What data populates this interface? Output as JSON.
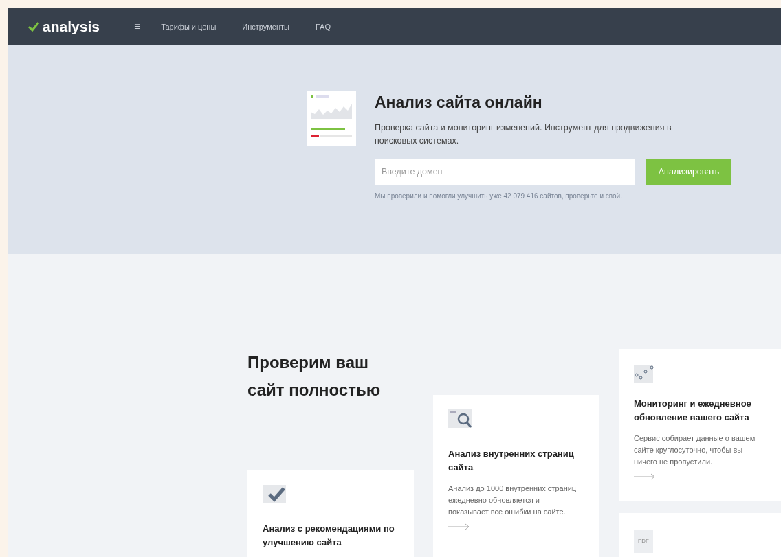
{
  "nav": {
    "logo": "analysis",
    "menu_icon": "≡",
    "links": [
      "Тарифы и цены",
      "Инструменты",
      "FAQ"
    ]
  },
  "hero": {
    "title": "Анализ сайта онлайн",
    "subtitle": "Проверка сайта и мониторинг изменений. Инструмент для продвижения в поисковых системах.",
    "search": {
      "placeholder": "Введите домен"
    },
    "button": "Анализировать",
    "note": "Мы проверили и помогли улучшить уже 42 079 416 сайтов, проверьте и свой."
  },
  "features": {
    "heading": "Проверим ваш сайт полностью",
    "cards": [
      {
        "kind": "check",
        "title": "Анализ с рекомендациями по улучшению сайта"
      },
      {
        "kind": "search",
        "title": "Анализ внутренних страниц сайта",
        "text": "Анализ до 1000 внутренних страниц ежедневно обновляется и показывает все ошибки на сайте."
      },
      {
        "kind": "graph",
        "title": "Мониторинг и ежедневное обновление вашего сайта",
        "text": "Сервис собирает данные о вашем сайте круглосуточно, чтобы вы ничего не пропустили."
      },
      {
        "kind": "pdf",
        "icon_label": "PDF"
      }
    ]
  }
}
